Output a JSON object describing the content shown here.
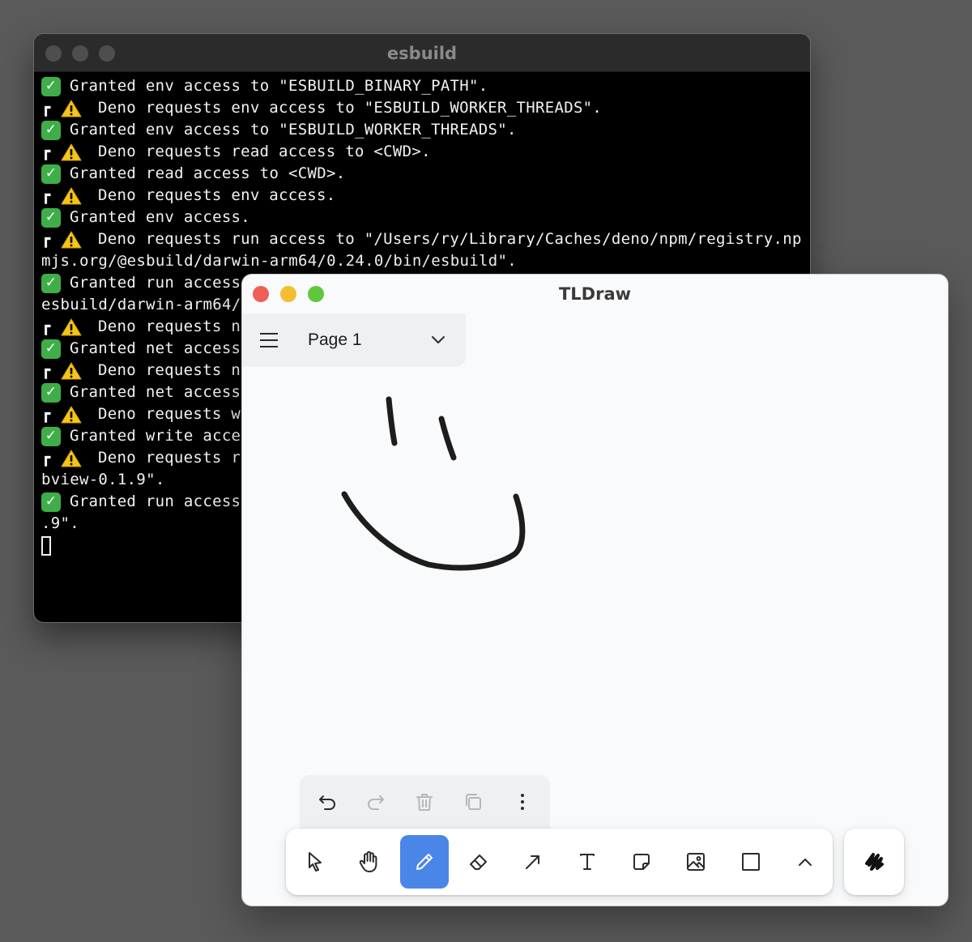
{
  "terminal": {
    "title": "esbuild",
    "lines": [
      {
        "kind": "ok",
        "text": "Granted env access to \"ESBUILD_BINARY_PATH\"."
      },
      {
        "kind": "warn",
        "text": "Deno requests env access to \"ESBUILD_WORKER_THREADS\"."
      },
      {
        "kind": "ok",
        "text": "Granted env access to \"ESBUILD_WORKER_THREADS\"."
      },
      {
        "kind": "warn",
        "text": "Deno requests read access to <CWD>."
      },
      {
        "kind": "ok",
        "text": "Granted read access to <CWD>."
      },
      {
        "kind": "warn",
        "text": "Deno requests env access."
      },
      {
        "kind": "ok",
        "text": "Granted env access."
      },
      {
        "kind": "warn",
        "text": "Deno requests run access to \"/Users/ry/Library/Caches/deno/npm/registry.np"
      },
      {
        "kind": "plain",
        "text": "mjs.org/@esbuild/darwin-arm64/0.24.0/bin/esbuild\"."
      },
      {
        "kind": "ok",
        "text": "Granted run access"
      },
      {
        "kind": "plain",
        "text": "esbuild/darwin-arm64/"
      },
      {
        "kind": "warn",
        "text": "Deno requests n"
      },
      {
        "kind": "ok",
        "text": "Granted net access"
      },
      {
        "kind": "warn",
        "text": "Deno requests n"
      },
      {
        "kind": "ok",
        "text": "Granted net access"
      },
      {
        "kind": "warn",
        "text": "Deno requests w"
      },
      {
        "kind": "ok",
        "text": "Granted write acce"
      },
      {
        "kind": "warn",
        "text": "Deno requests r"
      },
      {
        "kind": "plain",
        "text": "bview-0.1.9\"."
      },
      {
        "kind": "ok",
        "text": "Granted run access"
      },
      {
        "kind": "plain",
        "text": ".9\"."
      },
      {
        "kind": "cursor",
        "text": ""
      }
    ]
  },
  "tldraw": {
    "title": "TLDraw",
    "page_name": "Page 1",
    "traffic_colors": [
      "#ee5f57",
      "#f5bd31",
      "#5fc73d"
    ],
    "actions": [
      "undo-icon",
      "redo-icon",
      "trash-icon",
      "duplicate-icon",
      "more-icon"
    ],
    "tools": [
      "select-icon",
      "hand-icon",
      "pencil-icon",
      "eraser-icon",
      "arrow-icon",
      "text-icon",
      "note-icon",
      "image-icon",
      "rectangle-icon",
      "chevron-up-icon"
    ],
    "active_tool": "pencil-icon",
    "accent_color": "#4a86e8"
  }
}
